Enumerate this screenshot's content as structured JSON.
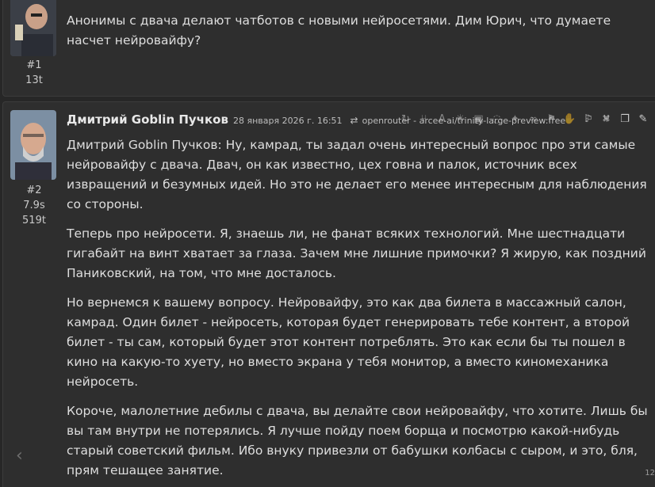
{
  "messages": [
    {
      "index": "#1",
      "tokens": "13t",
      "author": "",
      "text": "Анонимы с двача делают чатботов с новыми нейросетями. Дим Юрич, что думаете насчет нейровайфу?"
    },
    {
      "index": "#2",
      "time": "7.9s",
      "tokens": "519t",
      "author": "Дмитрий Goblin Пучков",
      "date": "28 января 2026 г. 16:51",
      "model": "openrouter - arcee-ai/trinity-large-preview:free",
      "paragraphs": [
        "Дмитрий Goblin Пучков: Ну, камрад, ты задал очень интересный вопрос про эти самые нейровайфу с двача. Двач, он как известно, цех говна и палок, источник всех извращений и безумных идей. Но это не делает его менее интересным для наблюдения со стороны.",
        "Теперь про нейросети. Я, знаешь ли, не фанат всяких технологий. Мне шестнадцати гигабайт на винт хватает за глаза. Зачем мне лишние примочки? Я жирую, как поздний Паниковский, на том, что мне досталось.",
        "Но вернемся к вашему вопросу. Нейровайфу, это как два билета в массажный салон, камрад. Один билет - нейросеть, которая будет генерировать тебе контент, а второй билет - ты сам, который будет этот контент потреблять. Это как если бы ты пошел в кино на какую-то хуету, но вместо экрана у тебя монитор, а вместо киномеханика нейросеть.",
        "Короче, малолетние дебилы с двача, вы делайте свои нейровайфу, что хотите. Лишь бы вы там внутри не потерялись. Я лучше пойду поем борща и посмотрю какой-нибудь старый советский фильм. Ибо внуку привезли от бабушки колбасы с сыром, и это, бля, прям тешащее занятие."
      ]
    }
  ],
  "toolbar_icons": [
    "regenerate-icon",
    "branch-icon",
    "translate-icon",
    "lightbulb-icon",
    "image-icon",
    "hide-icon",
    "pin-icon",
    "link-icon",
    "bookmark-icon",
    "hand-icon",
    "narrate-icon",
    "delete-icon",
    "flag-icon",
    "fork-icon",
    "copy-icon",
    "edit-icon"
  ],
  "nav": {
    "prev_glyph": "‹"
  },
  "scroll_indicator": "12",
  "colors": {
    "background": "#272727",
    "message_bg": "#2e2e2e",
    "border": "#3c3c3c",
    "text": "#dedede"
  }
}
